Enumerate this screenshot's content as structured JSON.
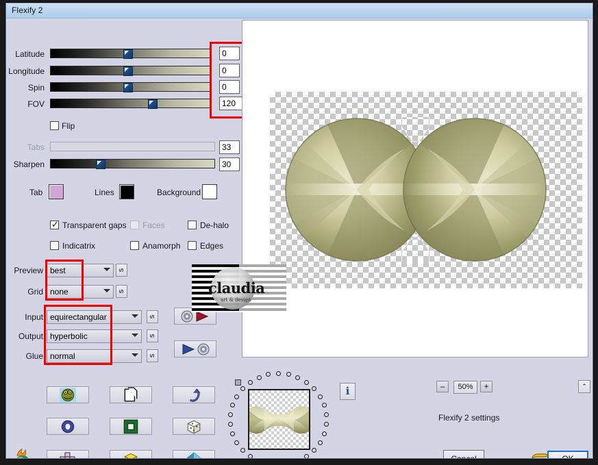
{
  "window": {
    "title": "Flexify 2"
  },
  "sliders": [
    {
      "label": "Latitude",
      "value": "0",
      "pos": 0.46,
      "disabled": false
    },
    {
      "label": "Longitude",
      "value": "0",
      "pos": 0.46,
      "disabled": false
    },
    {
      "label": "Spin",
      "value": "0",
      "pos": 0.46,
      "disabled": false
    },
    {
      "label": "FOV",
      "value": "120",
      "pos": 0.6,
      "disabled": false
    }
  ],
  "flip": {
    "label": "Flip",
    "checked": false
  },
  "extra_sliders": [
    {
      "label": "Tabs",
      "value": "33",
      "pos": 0.0,
      "disabled": true
    },
    {
      "label": "Sharpen",
      "value": "30",
      "pos": 0.28,
      "disabled": false
    }
  ],
  "colors": {
    "tab": {
      "label": "Tab",
      "hex": "#d3a6d5"
    },
    "lines": {
      "label": "Lines",
      "hex": "#000000"
    },
    "background": {
      "label": "Background",
      "hex": "#ffffff"
    }
  },
  "checkboxes": [
    {
      "label": "Transparent gaps",
      "checked": true,
      "disabled": false
    },
    {
      "label": "Faces",
      "checked": false,
      "disabled": true
    },
    {
      "label": "De-halo",
      "checked": false,
      "disabled": false
    },
    {
      "label": "Indicatrix",
      "checked": false,
      "disabled": false
    },
    {
      "label": "Anamorph",
      "checked": false,
      "disabled": false
    },
    {
      "label": "Edges",
      "checked": false,
      "disabled": false
    }
  ],
  "dropdowns": [
    {
      "label": "Preview",
      "value": "best",
      "side_button": "s"
    },
    {
      "label": "Grid",
      "value": "none",
      "side_button": "s"
    },
    {
      "label": "Input",
      "value": "equirectangular",
      "side_button": "s"
    },
    {
      "label": "Output",
      "value": "hyperbolic",
      "side_button": "s"
    },
    {
      "label": "Glue",
      "value": "normal",
      "side_button": "s"
    }
  ],
  "io_buttons": [
    {
      "name": "load-settings-button"
    },
    {
      "name": "save-settings-button"
    }
  ],
  "tool_buttons": [
    {
      "name": "preset-frog-button"
    },
    {
      "name": "copy-pages-button"
    },
    {
      "name": "undo-button"
    },
    {
      "name": "ring-button"
    },
    {
      "name": "frame-button"
    },
    {
      "name": "randomize-dice-button"
    },
    {
      "name": "cross-layout-button"
    },
    {
      "name": "cube-button"
    },
    {
      "name": "polyhedron-button"
    }
  ],
  "zoom_controls": {
    "minus": "–",
    "value": "50%",
    "plus": "+",
    "collapse": "⌃"
  },
  "footer": {
    "settings_label": "Flexify 2 settings",
    "cancel": "Cancel",
    "ok": "OK",
    "info": "i"
  },
  "watermark": {
    "text": "claudia",
    "subtext": "art & design"
  },
  "highlights": {
    "color": "#f40000",
    "regions": [
      "numeric-fields",
      "preview-grid-dropdowns",
      "input-output-glue-dropdowns"
    ]
  }
}
